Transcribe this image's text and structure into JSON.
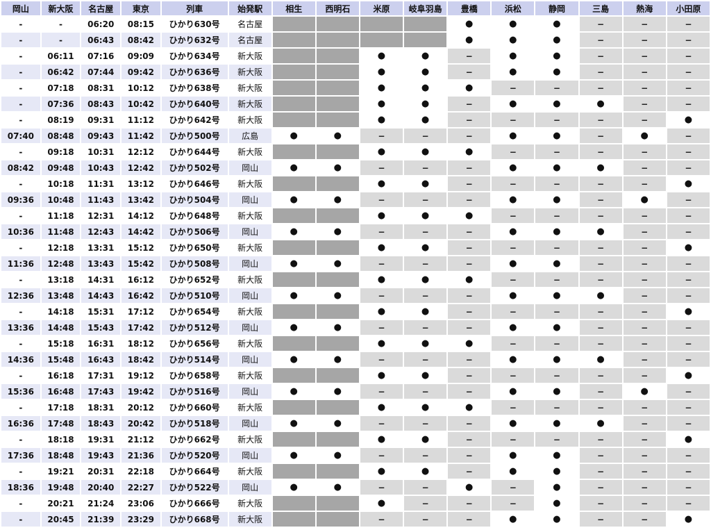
{
  "headers": [
    "岡山",
    "新大阪",
    "名古屋",
    "東京",
    "列車",
    "始発駅",
    "相生",
    "西明石",
    "米原",
    "岐阜羽島",
    "豊橋",
    "浜松",
    "静岡",
    "三島",
    "熱海",
    "小田原"
  ],
  "rows": [
    {
      "t": [
        "-",
        "-",
        "06:20",
        "08:15"
      ],
      "name": "ひかり630号",
      "origin": "名古屋",
      "m": "GGGGBBBDDD"
    },
    {
      "t": [
        "-",
        "-",
        "06:43",
        "08:42"
      ],
      "name": "ひかり632号",
      "origin": "名古屋",
      "m": "GGGGBBBDDD"
    },
    {
      "t": [
        "-",
        "06:11",
        "07:16",
        "09:09"
      ],
      "name": "ひかり634号",
      "origin": "新大阪",
      "m": "GGBBDBBDDD"
    },
    {
      "t": [
        "-",
        "06:42",
        "07:44",
        "09:42"
      ],
      "name": "ひかり636号",
      "origin": "新大阪",
      "m": "GGBBDBBDDD"
    },
    {
      "t": [
        "-",
        "07:18",
        "08:31",
        "10:12"
      ],
      "name": "ひかり638号",
      "origin": "新大阪",
      "m": "GGBBBDDDDD"
    },
    {
      "t": [
        "-",
        "07:36",
        "08:43",
        "10:42"
      ],
      "name": "ひかり640号",
      "origin": "新大阪",
      "m": "GGBBDBBBDD"
    },
    {
      "t": [
        "-",
        "08:19",
        "09:31",
        "11:12"
      ],
      "name": "ひかり642号",
      "origin": "新大阪",
      "m": "GGBBDDDDDB"
    },
    {
      "t": [
        "07:40",
        "08:48",
        "09:43",
        "11:42"
      ],
      "name": "ひかり500号",
      "origin": "広島",
      "m": "BBDDDBBDBD"
    },
    {
      "t": [
        "-",
        "09:18",
        "10:31",
        "12:12"
      ],
      "name": "ひかり644号",
      "origin": "新大阪",
      "m": "GGBBBDDDDD"
    },
    {
      "t": [
        "08:42",
        "09:48",
        "10:43",
        "12:42"
      ],
      "name": "ひかり502号",
      "origin": "岡山",
      "m": "BBDDDBBBDD"
    },
    {
      "t": [
        "-",
        "10:18",
        "11:31",
        "13:12"
      ],
      "name": "ひかり646号",
      "origin": "新大阪",
      "m": "GGBBDDDDDB"
    },
    {
      "t": [
        "09:36",
        "10:48",
        "11:43",
        "13:42"
      ],
      "name": "ひかり504号",
      "origin": "岡山",
      "m": "BBDDDBBDBD"
    },
    {
      "t": [
        "-",
        "11:18",
        "12:31",
        "14:12"
      ],
      "name": "ひかり648号",
      "origin": "新大阪",
      "m": "GGBBBDDDDD"
    },
    {
      "t": [
        "10:36",
        "11:48",
        "12:43",
        "14:42"
      ],
      "name": "ひかり506号",
      "origin": "岡山",
      "m": "BBDDDBBBDD"
    },
    {
      "t": [
        "-",
        "12:18",
        "13:31",
        "15:12"
      ],
      "name": "ひかり650号",
      "origin": "新大阪",
      "m": "GGBBDDDDDB"
    },
    {
      "t": [
        "11:36",
        "12:48",
        "13:43",
        "15:42"
      ],
      "name": "ひかり508号",
      "origin": "岡山",
      "m": "BBDDDBBDDD"
    },
    {
      "t": [
        "-",
        "13:18",
        "14:31",
        "16:12"
      ],
      "name": "ひかり652号",
      "origin": "新大阪",
      "m": "GGBBBDDDDD"
    },
    {
      "t": [
        "12:36",
        "13:48",
        "14:43",
        "16:42"
      ],
      "name": "ひかり510号",
      "origin": "岡山",
      "m": "BBDDDBBBDD"
    },
    {
      "t": [
        "-",
        "14:18",
        "15:31",
        "17:12"
      ],
      "name": "ひかり654号",
      "origin": "新大阪",
      "m": "GGBBDDDDDB"
    },
    {
      "t": [
        "13:36",
        "14:48",
        "15:43",
        "17:42"
      ],
      "name": "ひかり512号",
      "origin": "岡山",
      "m": "BBDDDBBDDD"
    },
    {
      "t": [
        "-",
        "15:18",
        "16:31",
        "18:12"
      ],
      "name": "ひかり656号",
      "origin": "新大阪",
      "m": "GGBBBDDDDD"
    },
    {
      "t": [
        "14:36",
        "15:48",
        "16:43",
        "18:42"
      ],
      "name": "ひかり514号",
      "origin": "岡山",
      "m": "BBDDDBBBDD"
    },
    {
      "t": [
        "-",
        "16:18",
        "17:31",
        "19:12"
      ],
      "name": "ひかり658号",
      "origin": "新大阪",
      "m": "GGBBDDDDDB"
    },
    {
      "t": [
        "15:36",
        "16:48",
        "17:43",
        "19:42"
      ],
      "name": "ひかり516号",
      "origin": "岡山",
      "m": "BBDDDBBDBD"
    },
    {
      "t": [
        "-",
        "17:18",
        "18:31",
        "20:12"
      ],
      "name": "ひかり660号",
      "origin": "新大阪",
      "m": "GGBBBDDDDD"
    },
    {
      "t": [
        "16:36",
        "17:48",
        "18:43",
        "20:42"
      ],
      "name": "ひかり518号",
      "origin": "岡山",
      "m": "BBDDDBBBDD"
    },
    {
      "t": [
        "-",
        "18:18",
        "19:31",
        "21:12"
      ],
      "name": "ひかり662号",
      "origin": "新大阪",
      "m": "GGBBDDDDDB"
    },
    {
      "t": [
        "17:36",
        "18:48",
        "19:43",
        "21:36"
      ],
      "name": "ひかり520号",
      "origin": "岡山",
      "m": "BBDDDBBDDD"
    },
    {
      "t": [
        "-",
        "19:21",
        "20:31",
        "22:18"
      ],
      "name": "ひかり664号",
      "origin": "新大阪",
      "m": "GGBBDBBDDD"
    },
    {
      "t": [
        "18:36",
        "19:48",
        "20:40",
        "22:27"
      ],
      "name": "ひかり522号",
      "origin": "岡山",
      "m": "BBDDBDBDDD"
    },
    {
      "t": [
        "-",
        "20:21",
        "21:24",
        "23:06"
      ],
      "name": "ひかり666号",
      "origin": "新大阪",
      "m": "GGBDDDBDDD"
    },
    {
      "t": [
        "-",
        "20:45",
        "21:39",
        "23:29"
      ],
      "name": "ひかり668号",
      "origin": "新大阪",
      "m": "GGDDDBBDDB"
    }
  ],
  "symbols": {
    "stop": "●",
    "pass": "−"
  },
  "colors": {
    "header": "#ccd0ee",
    "time_alt": "#e6e8f6",
    "gray": "#a6a6a6",
    "pass": "#dadada",
    "stop": "#ffffff"
  }
}
